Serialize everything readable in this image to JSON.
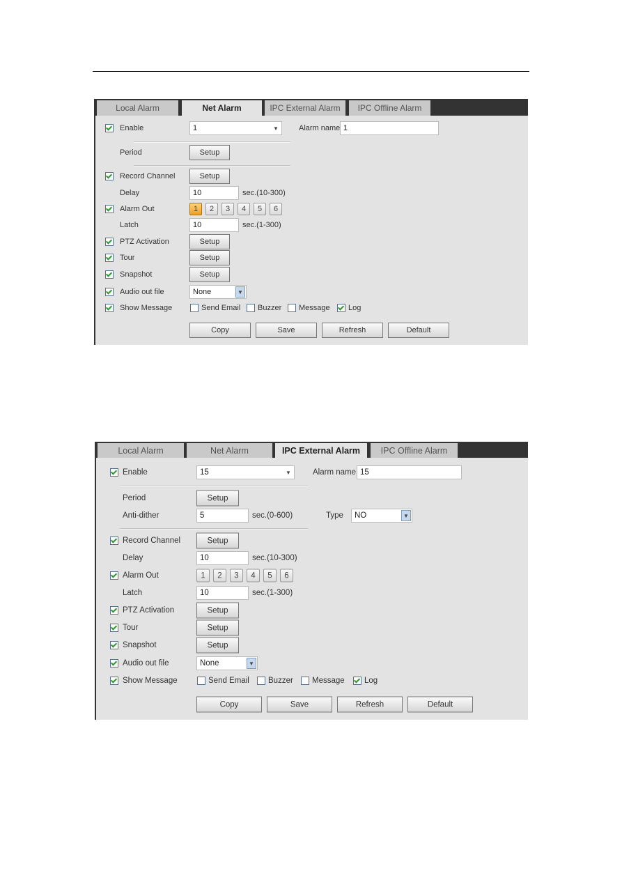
{
  "panels": [
    {
      "tabs": [
        "Local Alarm",
        "Net Alarm",
        "IPC External Alarm",
        "IPC Offline Alarm"
      ],
      "active_tab": 1,
      "enable": {
        "label": "Enable",
        "checked": true,
        "value": "1"
      },
      "alarm_name": {
        "label": "Alarm name",
        "value": "1"
      },
      "period": {
        "label": "Period",
        "button": "Setup"
      },
      "record_channel": {
        "label": "Record Channel",
        "checked": true,
        "button": "Setup"
      },
      "delay": {
        "label": "Delay",
        "value": "10",
        "unit": "sec.(10-300)"
      },
      "alarm_out": {
        "label": "Alarm Out",
        "checked": true,
        "channels": [
          "1",
          "2",
          "3",
          "4",
          "5",
          "6"
        ],
        "selected": [
          "1"
        ]
      },
      "latch": {
        "label": "Latch",
        "value": "10",
        "unit": "sec.(1-300)"
      },
      "ptz_activation": {
        "label": "PTZ Activation",
        "checked": true,
        "button": "Setup"
      },
      "tour": {
        "label": "Tour",
        "checked": true,
        "button": "Setup"
      },
      "snapshot": {
        "label": "Snapshot",
        "checked": true,
        "button": "Setup"
      },
      "audio_out_file": {
        "label": "Audio out file",
        "checked": true,
        "value": "None"
      },
      "show_message": {
        "label": "Show Message",
        "checked": true,
        "options": [
          {
            "label": "Send Email",
            "checked": false
          },
          {
            "label": "Buzzer",
            "checked": false
          },
          {
            "label": "Message",
            "checked": false
          },
          {
            "label": "Log",
            "checked": true
          }
        ]
      },
      "buttons": [
        "Copy",
        "Save",
        "Refresh",
        "Default"
      ]
    },
    {
      "tabs": [
        "Local Alarm",
        "Net Alarm",
        "IPC External Alarm",
        "IPC Offline Alarm"
      ],
      "active_tab": 2,
      "enable": {
        "label": "Enable",
        "checked": true,
        "value": "15"
      },
      "alarm_name": {
        "label": "Alarm name",
        "value": "15"
      },
      "period": {
        "label": "Period",
        "button": "Setup"
      },
      "anti_dither": {
        "label": "Anti-dither",
        "value": "5",
        "unit": "sec.(0-600)"
      },
      "type": {
        "label": "Type",
        "value": "NO"
      },
      "record_channel": {
        "label": "Record Channel",
        "checked": true,
        "button": "Setup"
      },
      "delay": {
        "label": "Delay",
        "value": "10",
        "unit": "sec.(10-300)"
      },
      "alarm_out": {
        "label": "Alarm Out",
        "checked": true,
        "channels": [
          "1",
          "2",
          "3",
          "4",
          "5",
          "6"
        ],
        "selected": []
      },
      "latch": {
        "label": "Latch",
        "value": "10",
        "unit": "sec.(1-300)"
      },
      "ptz_activation": {
        "label": "PTZ Activation",
        "checked": true,
        "button": "Setup"
      },
      "tour": {
        "label": "Tour",
        "checked": true,
        "button": "Setup"
      },
      "snapshot": {
        "label": "Snapshot",
        "checked": true,
        "button": "Setup"
      },
      "audio_out_file": {
        "label": "Audio out file",
        "checked": true,
        "value": "None"
      },
      "show_message": {
        "label": "Show Message",
        "checked": true,
        "options": [
          {
            "label": "Send Email",
            "checked": false
          },
          {
            "label": "Buzzer",
            "checked": false
          },
          {
            "label": "Message",
            "checked": false
          },
          {
            "label": "Log",
            "checked": true
          }
        ]
      },
      "buttons": [
        "Copy",
        "Save",
        "Refresh",
        "Default"
      ]
    }
  ]
}
